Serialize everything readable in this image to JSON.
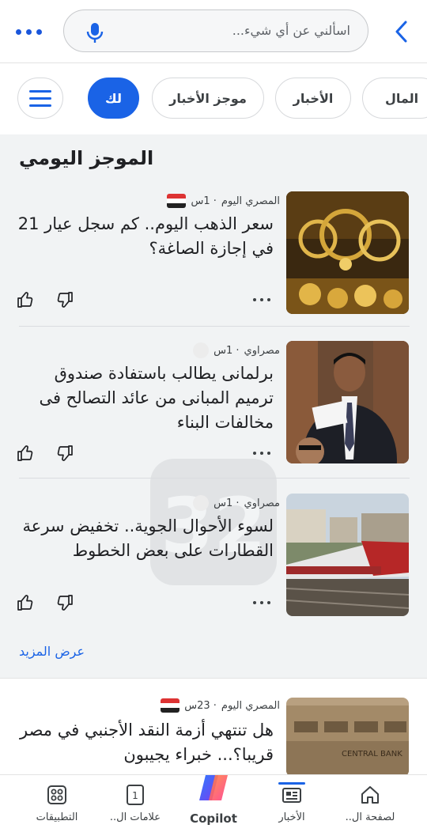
{
  "search": {
    "placeholder": "اسألني عن أي شيء..."
  },
  "tabs": [
    {
      "label": "المال"
    },
    {
      "label": "الأخبار"
    },
    {
      "label": "موجز الأخبار"
    },
    {
      "label": "لك"
    }
  ],
  "brief": {
    "title": "الموجز اليومي",
    "see_more": "عرض المزيد",
    "articles": [
      {
        "source": "المصري اليوم",
        "time": "· 1س",
        "headline": "سعر الذهب اليوم.. كم سجل عيار 21 في إجازة الصاغة؟"
      },
      {
        "source": "مصراوي",
        "time": "· 1س",
        "headline": "برلمانى يطالب باستفادة صندوق ترميم المبانى من عائد التصالح فى مخالفات البناء"
      },
      {
        "source": "مصراوي",
        "time": "· 1س",
        "headline": "لسوء الأحوال الجوية.. تخفيض سرعة القطارات على بعض الخطوط"
      }
    ]
  },
  "feed": {
    "article": {
      "source": "المصري اليوم",
      "time": "· 23س",
      "headline": "هل تنتهي أزمة النقد الأجنبي في مصر قريبا؟... خبراء يجيبون"
    }
  },
  "bottom_nav": [
    {
      "label": "لصفحة ال..",
      "icon": "home-icon"
    },
    {
      "label": "الأخبار",
      "icon": "news-icon",
      "active": true
    },
    {
      "label": "Copilot",
      "icon": "copilot-icon"
    },
    {
      "label": "علامات ال..",
      "icon": "tabs-count-icon",
      "count": "1"
    },
    {
      "label": "التطبيقات",
      "icon": "apps-grid-icon"
    }
  ],
  "colors": {
    "accent": "#1a63e6",
    "background": "#f1f3f4"
  }
}
